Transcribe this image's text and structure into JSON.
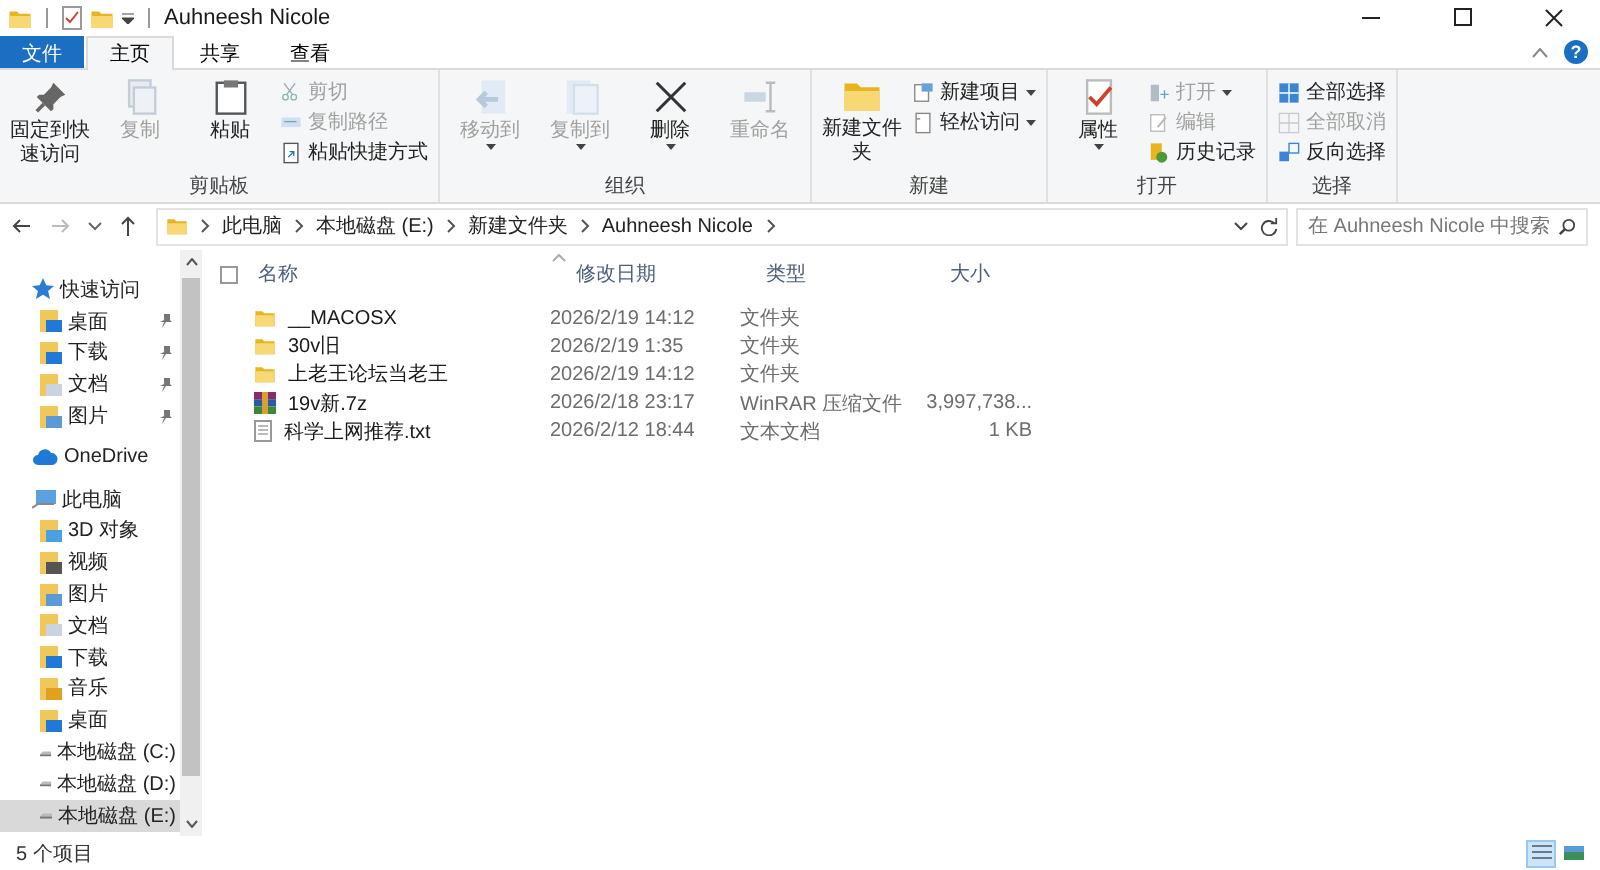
{
  "window": {
    "title": "Auhneesh Nicole",
    "buttons": [
      {
        "kind": "minimize"
      },
      {
        "kind": "maximize"
      },
      {
        "kind": "close"
      }
    ]
  },
  "ribbon_tabs": [
    {
      "label": "文件",
      "kind": "file",
      "selected": false
    },
    {
      "label": "主页",
      "kind": "tab",
      "selected": true
    },
    {
      "label": "共享",
      "kind": "tab",
      "selected": false
    },
    {
      "label": "查看",
      "kind": "tab",
      "selected": false
    }
  ],
  "help_button": "?",
  "ribbon_groups": [
    {
      "label": "剪贴板",
      "items": [
        {
          "kind": "large",
          "label": "固定到快速访问",
          "disabled": false,
          "dropdown": false
        },
        {
          "kind": "large",
          "label": "复制",
          "disabled": true,
          "dropdown": false
        },
        {
          "kind": "large",
          "label": "粘贴",
          "disabled": false,
          "dropdown": false
        },
        {
          "kind": "small",
          "label": "剪切",
          "disabled": true,
          "dropdown": false
        },
        {
          "kind": "small",
          "label": "复制路径",
          "disabled": true,
          "dropdown": false
        },
        {
          "kind": "small",
          "label": "粘贴快捷方式",
          "disabled": false,
          "dropdown": false
        }
      ]
    },
    {
      "label": "组织",
      "items": [
        {
          "kind": "large",
          "label": "移动到",
          "disabled": true,
          "dropdown": true
        },
        {
          "kind": "large",
          "label": "复制到",
          "disabled": true,
          "dropdown": true
        },
        {
          "kind": "large",
          "label": "删除",
          "disabled": false,
          "dropdown": true
        },
        {
          "kind": "large",
          "label": "重命名",
          "disabled": true,
          "dropdown": false
        }
      ]
    },
    {
      "label": "新建",
      "items": [
        {
          "kind": "large",
          "label": "新建文件夹",
          "disabled": false,
          "dropdown": false
        },
        {
          "kind": "small",
          "label": "新建项目",
          "disabled": false,
          "dropdown": true
        },
        {
          "kind": "small",
          "label": "轻松访问",
          "disabled": false,
          "dropdown": true
        }
      ]
    },
    {
      "label": "打开",
      "items": [
        {
          "kind": "large",
          "label": "属性",
          "disabled": false,
          "dropdown": true
        },
        {
          "kind": "small",
          "label": "打开",
          "disabled": true,
          "dropdown": true
        },
        {
          "kind": "small",
          "label": "编辑",
          "disabled": true,
          "dropdown": false
        },
        {
          "kind": "small",
          "label": "历史记录",
          "disabled": false,
          "dropdown": false
        }
      ]
    },
    {
      "label": "选择",
      "items": [
        {
          "kind": "small",
          "label": "全部选择",
          "disabled": false,
          "dropdown": false
        },
        {
          "kind": "small",
          "label": "全部取消",
          "disabled": true,
          "dropdown": false
        },
        {
          "kind": "small",
          "label": "反向选择",
          "disabled": false,
          "dropdown": false
        }
      ]
    }
  ],
  "address_bar": {
    "path": [
      "此电脑",
      "本地磁盘 (E:)",
      "新建文件夹",
      "Auhneesh Nicole"
    ]
  },
  "search": {
    "placeholder": "在 Auhneesh Nicole 中搜索"
  },
  "sidebar": {
    "items": [
      {
        "label": "快速访问",
        "kind": "star",
        "selected": false,
        "children": [
          {
            "label": "桌面",
            "kind": "desktop",
            "pinned": true,
            "selected": false
          },
          {
            "label": "下载",
            "kind": "download",
            "pinned": true,
            "selected": false
          },
          {
            "label": "文档",
            "kind": "docs",
            "pinned": true,
            "selected": false
          },
          {
            "label": "图片",
            "kind": "pictures",
            "pinned": true,
            "selected": false
          }
        ]
      },
      {
        "label": "OneDrive",
        "kind": "cloud",
        "selected": false
      },
      {
        "label": "此电脑",
        "kind": "pc",
        "selected": false,
        "children": [
          {
            "label": "3D 对象",
            "kind": "folder",
            "pinned": false,
            "selected": false
          },
          {
            "label": "视频",
            "kind": "video",
            "pinned": false,
            "selected": false
          },
          {
            "label": "图片",
            "kind": "pictures",
            "pinned": false,
            "selected": false
          },
          {
            "label": "文档",
            "kind": "docs",
            "pinned": false,
            "selected": false
          },
          {
            "label": "下载",
            "kind": "download",
            "pinned": false,
            "selected": false
          },
          {
            "label": "音乐",
            "kind": "music",
            "pinned": false,
            "selected": false
          },
          {
            "label": "桌面",
            "kind": "desktop",
            "pinned": false,
            "selected": false
          },
          {
            "label": "本地磁盘 (C:)",
            "kind": "drive",
            "pinned": false,
            "selected": false
          },
          {
            "label": "本地磁盘 (D:)",
            "kind": "drive",
            "pinned": false,
            "selected": false
          },
          {
            "label": "本地磁盘 (E:)",
            "kind": "drive",
            "pinned": false,
            "selected": true
          }
        ]
      }
    ]
  },
  "file_list": {
    "select_all_checked": false,
    "columns": [
      "名称",
      "修改日期",
      "类型",
      "大小"
    ],
    "rows": [
      {
        "kind": "folder",
        "name": "__MACOSX",
        "modified": "2026/2/19 14:12",
        "type": "文件夹",
        "size": ""
      },
      {
        "kind": "folder",
        "name": "30v旧",
        "modified": "2026/2/19 1:35",
        "type": "文件夹",
        "size": ""
      },
      {
        "kind": "folder",
        "name": "上老王论坛当老王",
        "modified": "2026/2/19 14:12",
        "type": "文件夹",
        "size": ""
      },
      {
        "kind": "archive",
        "name": "19v新.7z",
        "modified": "2026/2/18 23:17",
        "type": "WinRAR 压缩文件",
        "size": "3,997,738..."
      },
      {
        "kind": "text",
        "name": "科学上网推荐.txt",
        "modified": "2026/2/12 18:44",
        "type": "文本文档",
        "size": "1 KB"
      }
    ]
  },
  "status_bar": {
    "item_count": "5 个项目",
    "views": [
      {
        "kind": "details",
        "selected": true
      },
      {
        "kind": "large_icons",
        "selected": false
      }
    ]
  }
}
